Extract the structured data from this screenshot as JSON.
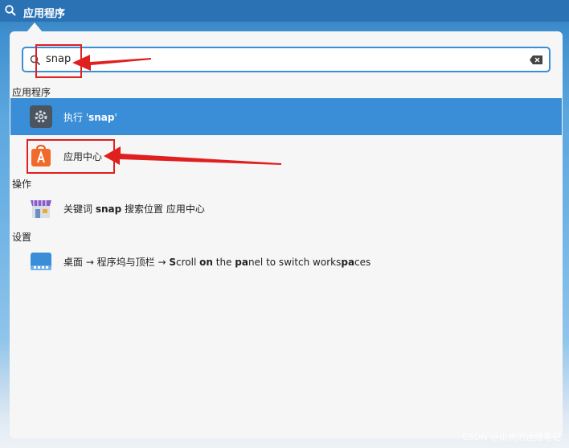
{
  "topbar": {
    "title": "应用程序",
    "search_icon": "search-icon"
  },
  "search": {
    "value": "snap",
    "icon": "search-icon",
    "clear_icon": "clear-icon"
  },
  "categories": {
    "apps": "应用程序",
    "actions": "操作",
    "settings": "设置"
  },
  "results": {
    "run": {
      "prefix": "执行 '",
      "keyword": "snap",
      "suffix": "'",
      "icon": "gear-icon"
    },
    "app_center": {
      "label": "应用中心",
      "icon": "app-center-icon"
    },
    "search_in": {
      "prefix": "关键词 ",
      "keyword": "snap",
      "suffix": " 搜索位置 应用中心",
      "icon": "store-icon"
    },
    "setting": {
      "part1": "桌面 → 程序坞与顶栏 → ",
      "b1": "S",
      "part2": "croll ",
      "b2": "on",
      "part3": " the ",
      "b3": "pa",
      "part4": "nel to switch works",
      "b4": "pa",
      "part5": "ces",
      "icon": "display-icon"
    }
  },
  "watermark": "CSDN @山岚的运维笔记",
  "colors": {
    "selection": "#3a8ed8",
    "annotation": "#e01f1f"
  }
}
